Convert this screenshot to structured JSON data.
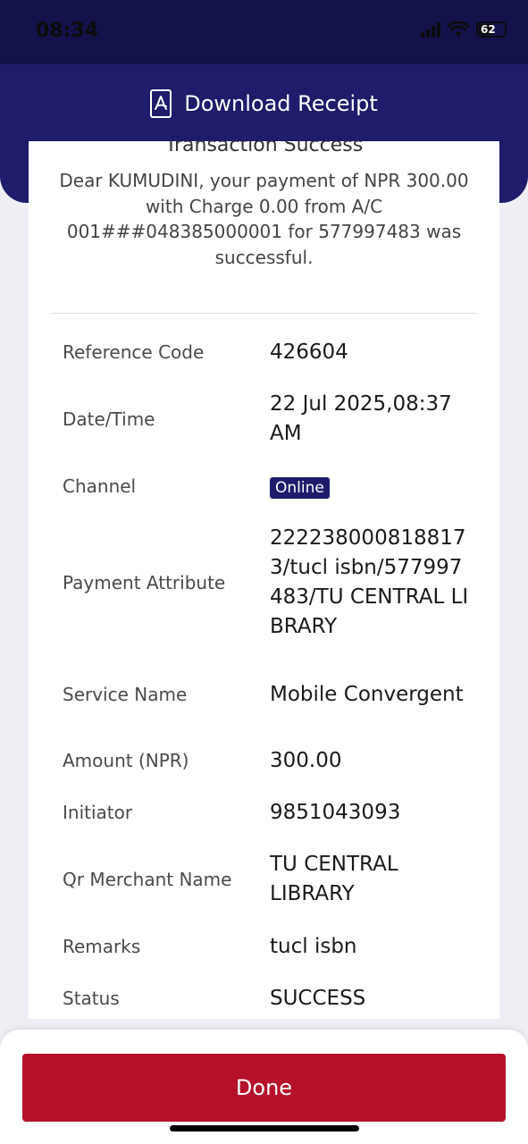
{
  "status_bar": {
    "time": "08:34",
    "battery": "62"
  },
  "header": {
    "download_label": "Download Receipt"
  },
  "card": {
    "title": "Transaction Success",
    "message": "Dear KUMUDINI, your payment of NPR 300.00 with Charge 0.00 from A/C 001###048385000001 for 577997483 was successful."
  },
  "details": [
    {
      "label": "Reference Code",
      "value": "426604"
    },
    {
      "label": "Date/Time",
      "value": "22 Jul 2025,08:37 AM"
    },
    {
      "label": "Channel",
      "value": "Online"
    },
    {
      "label": "Payment Attribute",
      "value": "2222380008188173/tucl isbn/577997483/TU CENTRAL LIBRARY"
    },
    {
      "label": "Service Name",
      "value": "Mobile Convergent"
    },
    {
      "label": "Amount (NPR)",
      "value": "300.00"
    },
    {
      "label": "Initiator",
      "value": "9851043093"
    },
    {
      "label": "Qr Merchant Name",
      "value": "TU CENTRAL LIBRARY"
    },
    {
      "label": "Remarks",
      "value": "tucl isbn"
    },
    {
      "label": "Status",
      "value": "SUCCESS"
    }
  ],
  "footer": {
    "done_label": "Done"
  },
  "colors": {
    "header": "#1e1c6b",
    "done_button": "#b5112a"
  }
}
